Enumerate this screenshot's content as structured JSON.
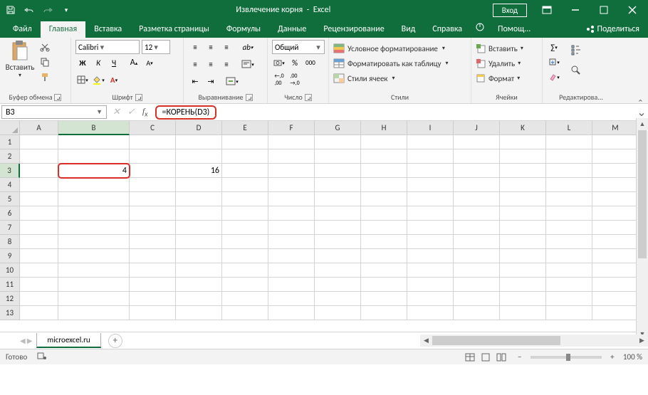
{
  "title": {
    "doc": "Извлечение корня",
    "app": "Excel"
  },
  "qat": {
    "login": "Вход"
  },
  "tabs": {
    "file": "Файл",
    "home": "Главная",
    "insert": "Вставка",
    "layout": "Разметка страницы",
    "formulas": "Формулы",
    "data": "Данные",
    "review": "Рецензирование",
    "view": "Вид",
    "help": "Справка",
    "assist": "Помощ...",
    "share": "Поделиться"
  },
  "ribbon": {
    "clipboard": {
      "paste": "Вставить",
      "label": "Буфер обмена"
    },
    "font": {
      "name": "Calibri",
      "size": "12",
      "label": "Шрифт"
    },
    "align": {
      "label": "Выравнивание"
    },
    "number": {
      "format": "Общий",
      "label": "Число"
    },
    "styles": {
      "cond": "Условное форматирование",
      "table": "Форматировать как таблицу",
      "cell": "Стили ячеек",
      "label": "Стили"
    },
    "cells": {
      "insert": "Вставить",
      "delete": "Удалить",
      "format": "Формат",
      "label": "Ячейки"
    },
    "edit": {
      "label": "Редактирова..."
    }
  },
  "formula": {
    "cellref": "B3",
    "value": "=КОРЕНЬ(D3)"
  },
  "columns": [
    "A",
    "B",
    "C",
    "D",
    "E",
    "F",
    "G",
    "H",
    "I",
    "J",
    "K",
    "L",
    "M"
  ],
  "rows": [
    "1",
    "2",
    "3",
    "4",
    "5",
    "6",
    "7",
    "8",
    "9",
    "10",
    "11",
    "12",
    "13"
  ],
  "cells": {
    "B3": "4",
    "D3": "16"
  },
  "sheet": {
    "name": "microexcel.ru"
  },
  "status": {
    "ready": "Готово",
    "zoom": "100 %"
  }
}
